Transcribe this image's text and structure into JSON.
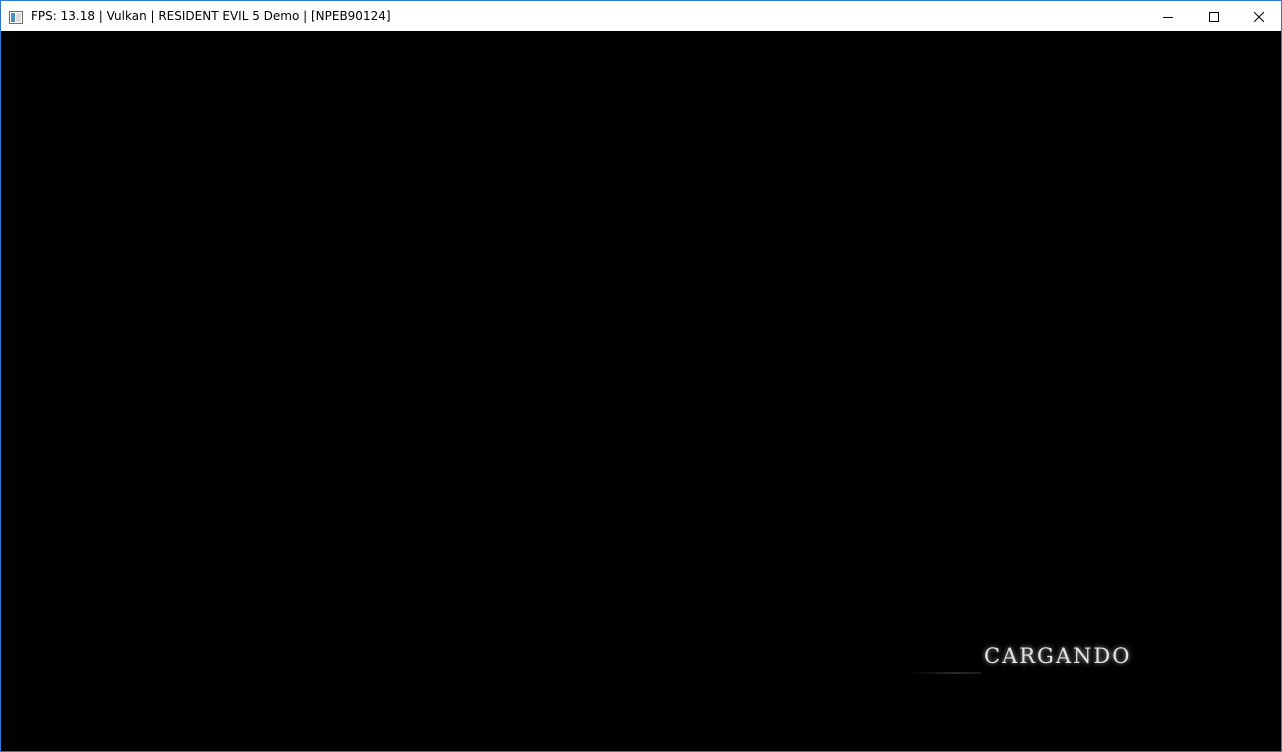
{
  "window": {
    "title": "FPS: 13.18 | Vulkan | RESIDENT EVIL 5 Demo | [NPEB90124]",
    "border_color": "#2b79d8",
    "app_icon": "window-app-icon",
    "controls": {
      "minimize": "minimize-icon",
      "maximize": "maximize-icon",
      "close": "close-icon"
    }
  },
  "game": {
    "background_color": "#000000",
    "loading_text": "CARGANDO"
  }
}
